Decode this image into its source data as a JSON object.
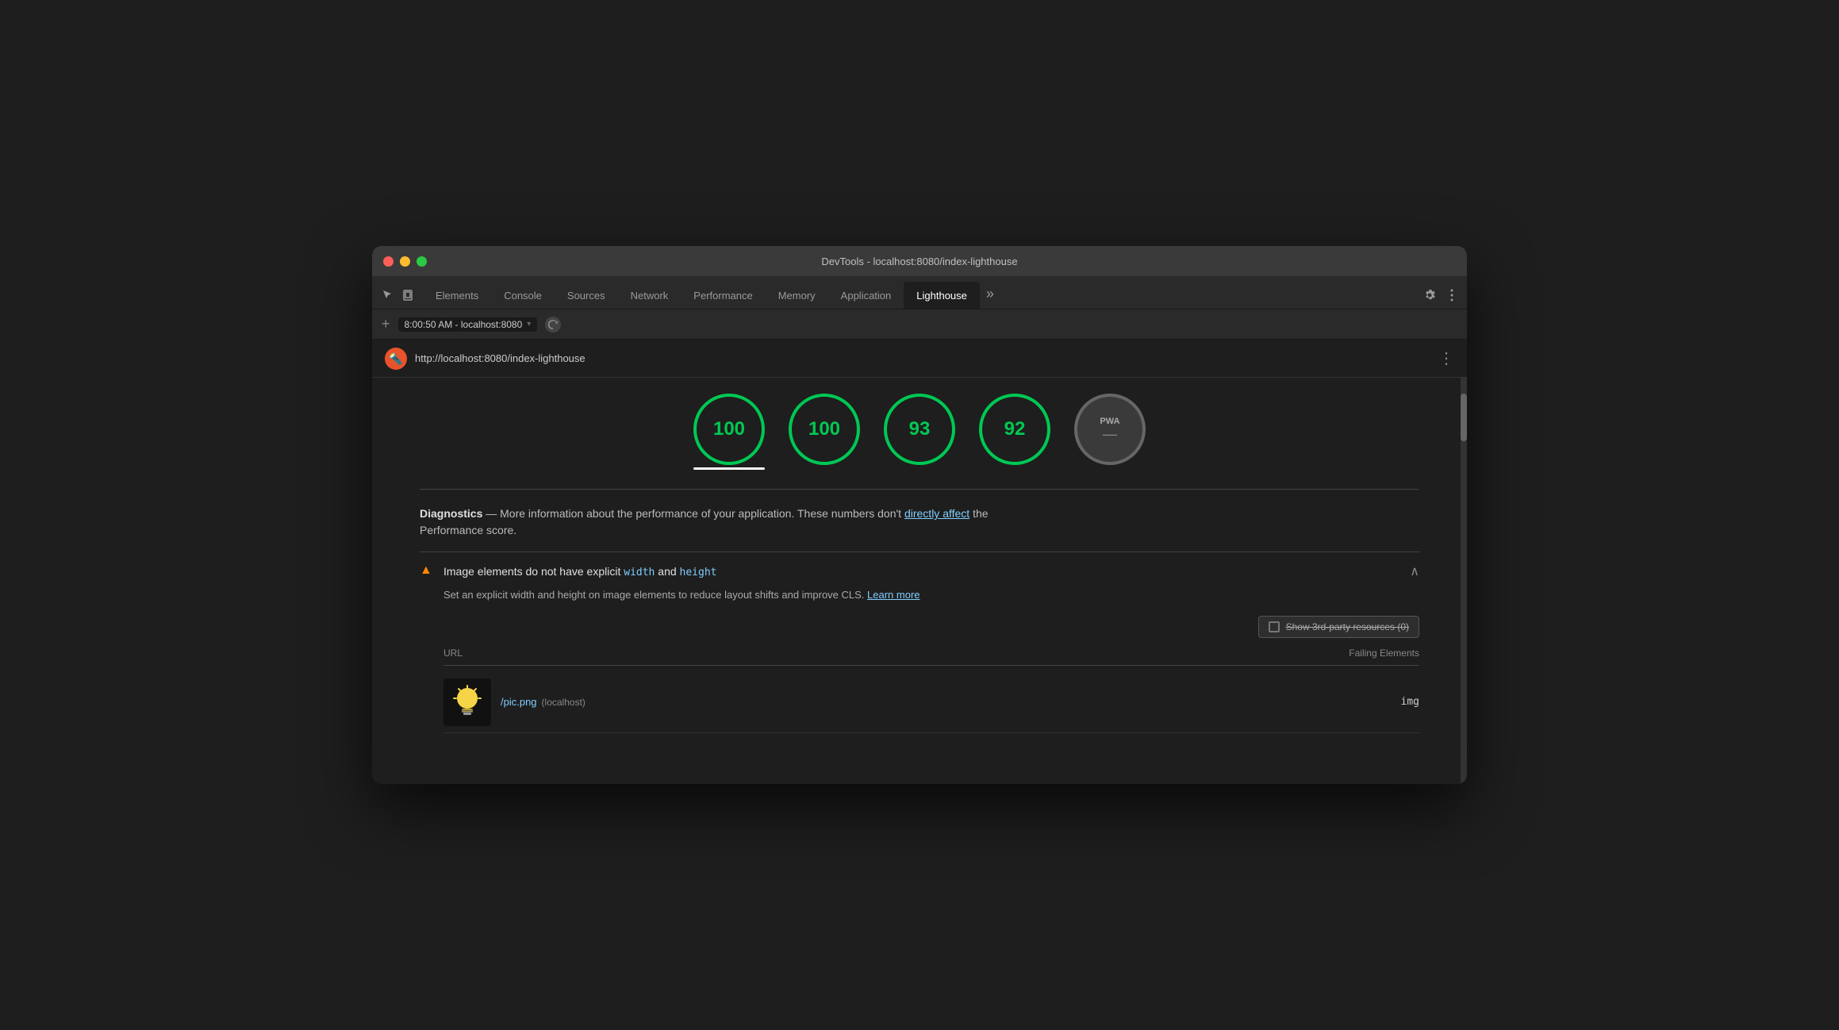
{
  "window": {
    "title": "DevTools - localhost:8080/index-lighthouse"
  },
  "traffic_lights": {
    "red": "#ff5f57",
    "yellow": "#ffbd2e",
    "green": "#28ca41"
  },
  "tabs": [
    {
      "id": "elements",
      "label": "Elements",
      "active": false
    },
    {
      "id": "console",
      "label": "Console",
      "active": false
    },
    {
      "id": "sources",
      "label": "Sources",
      "active": false
    },
    {
      "id": "network",
      "label": "Network",
      "active": false
    },
    {
      "id": "performance",
      "label": "Performance",
      "active": false
    },
    {
      "id": "memory",
      "label": "Memory",
      "active": false
    },
    {
      "id": "application",
      "label": "Application",
      "active": false
    },
    {
      "id": "lighthouse",
      "label": "Lighthouse",
      "active": true
    }
  ],
  "toolbar": {
    "address": "8:00:50 AM - localhost:8080",
    "plus_label": "+",
    "more_icon": "⋮"
  },
  "lh_header": {
    "url": "http://localhost:8080/index-lighthouse",
    "more_btn": "⋮"
  },
  "scores": [
    {
      "id": "score-1",
      "value": "100",
      "underline": true
    },
    {
      "id": "score-2",
      "value": "100",
      "underline": false
    },
    {
      "id": "score-3",
      "value": "93",
      "underline": false
    },
    {
      "id": "score-4",
      "value": "92",
      "underline": false
    }
  ],
  "pwa_circle": {
    "label": "PWA",
    "dash": "—"
  },
  "diagnostics": {
    "section_title": "Diagnostics",
    "separator": "—",
    "description_before_link": "More information about the performance of your application. These numbers don't ",
    "link_text": "directly affect",
    "description_after_link": " the",
    "description_line2": "Performance score."
  },
  "audit": {
    "warning_icon": "▲",
    "title_before_code": "Image elements do not have explicit ",
    "code_width": "width",
    "title_and": " and ",
    "code_height": "height",
    "chevron": "∧",
    "description": "Set an explicit width and height on image elements to reduce layout shifts and improve CLS. ",
    "learn_more": "Learn more",
    "third_party_label": "Show 3rd-party resources (0)",
    "table_col_url": "URL",
    "table_col_failing": "Failing Elements",
    "row_url": "/pic.png",
    "row_host": "(localhost)",
    "row_failing": "img"
  }
}
